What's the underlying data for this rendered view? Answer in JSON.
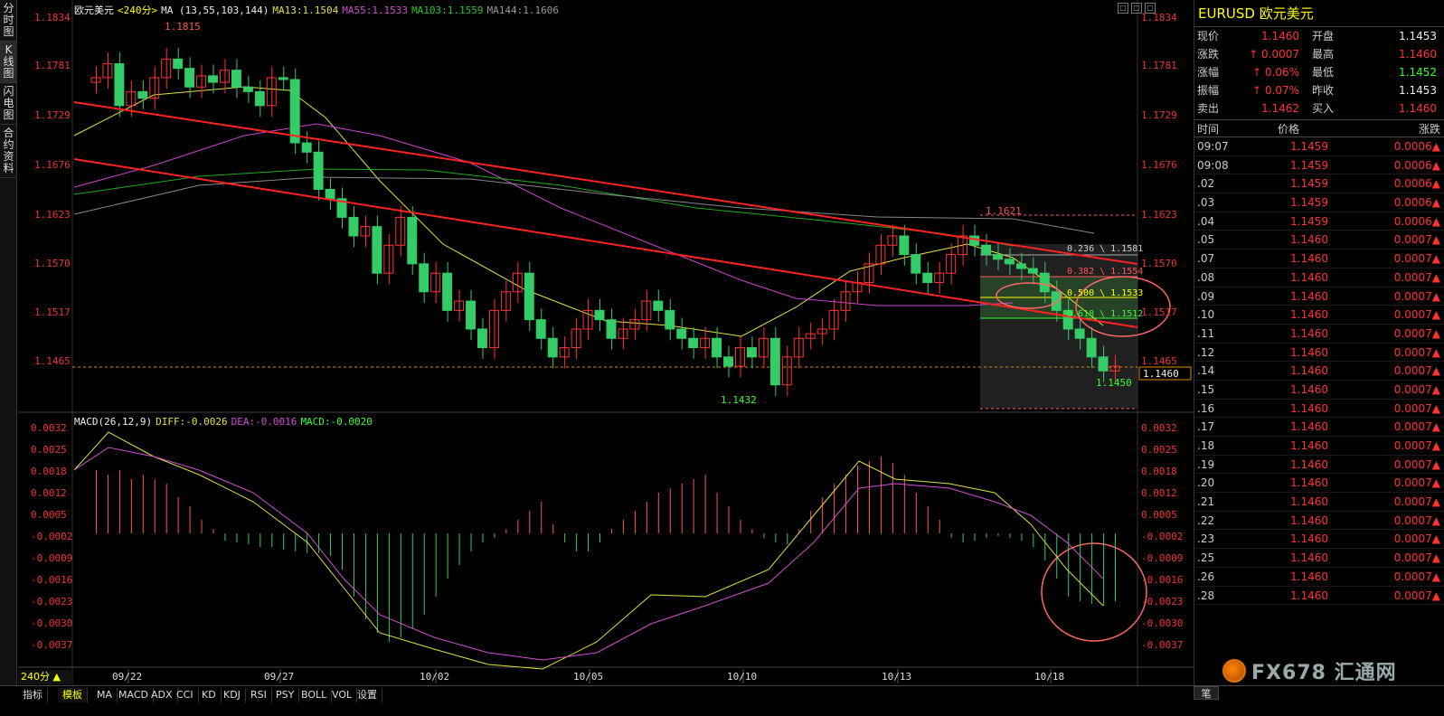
{
  "left_tabs": [
    "分时图",
    "K线图",
    "闪电图",
    "合约资料"
  ],
  "header": {
    "symbol": "欧元美元",
    "period": "<240分>",
    "ma_title": "MA (13,55,103,144)",
    "ma13": "MA13:1.1504",
    "ma55": "MA55:1.1533",
    "ma103": "MA103:1.1559",
    "ma144": "MA144:1.1606"
  },
  "window_buttons": [
    "□",
    "□",
    "□"
  ],
  "macd_header": {
    "title": "MACD(26,12,9)",
    "diff": "DIFF:-0.0026",
    "dea": "DEA:-0.0016",
    "macd": "MACD:-0.0020"
  },
  "price_axis": [
    "1.1834",
    "1.1781",
    "1.1729",
    "1.1676",
    "1.1623",
    "1.1570",
    "1.1517",
    "1.1465"
  ],
  "macd_axis": [
    "0.0032",
    "0.0025",
    "0.0018",
    "0.0012",
    "0.0005",
    "-0.0002",
    "-0.0009",
    "-0.0016",
    "-0.0023",
    "-0.0030",
    "-0.0037"
  ],
  "x_labels": [
    "09/22",
    "09/27",
    "10/02",
    "10/05",
    "10/10",
    "10/13",
    "10/18"
  ],
  "annotations": {
    "high": "1.1815",
    "low": "1.1432",
    "peak": "1.1621",
    "last_low": "1.1450",
    "current_tag": "1.1460",
    "fib_236": "0.236 \\ 1.1581",
    "fib_382": "0.382 \\ 1.1554",
    "fib_500": "0.500 \\ 1.1533",
    "fib_618": "0.618 \\ 1.1512"
  },
  "timeframe_button": "240分 ▲",
  "bottom_tabs": [
    "指标",
    "模板",
    "MA",
    "MACD",
    "ADX",
    "CCI",
    "KD",
    "KDJ",
    "RSI",
    "PSY",
    "BOLL",
    "VOL",
    "设置"
  ],
  "quote": {
    "title": "EURUSD 欧元美元",
    "rows": [
      {
        "l1": "现价",
        "v1": "1.1460",
        "c1": "red",
        "l2": "开盘",
        "v2": "1.1453",
        "c2": "white"
      },
      {
        "l1": "涨跌",
        "v1": "↑ 0.0007",
        "c1": "red",
        "l2": "最高",
        "v2": "1.1460",
        "c2": "red"
      },
      {
        "l1": "涨幅",
        "v1": "↑ 0.06%",
        "c1": "red",
        "l2": "最低",
        "v2": "1.1452",
        "c2": "green"
      },
      {
        "l1": "振幅",
        "v1": "↑ 0.07%",
        "c1": "red",
        "l2": "昨收",
        "v2": "1.1453",
        "c2": "white"
      },
      {
        "l1": "卖出",
        "v1": "1.1462",
        "c1": "red",
        "l2": "买入",
        "v2": "1.1460",
        "c2": "red"
      }
    ],
    "tick_header": [
      "时间",
      "价格",
      "涨跌"
    ],
    "ticks": [
      {
        "t": "09:07",
        "p": "1.1459",
        "c": "0.0006"
      },
      {
        "t": "09:08",
        "p": "1.1459",
        "c": "0.0006"
      },
      {
        "t": ".02",
        "p": "1.1459",
        "c": "0.0006"
      },
      {
        "t": ".03",
        "p": "1.1459",
        "c": "0.0006"
      },
      {
        "t": ".04",
        "p": "1.1459",
        "c": "0.0006"
      },
      {
        "t": ".05",
        "p": "1.1460",
        "c": "0.0007"
      },
      {
        "t": ".07",
        "p": "1.1460",
        "c": "0.0007"
      },
      {
        "t": ".08",
        "p": "1.1460",
        "c": "0.0007"
      },
      {
        "t": ".09",
        "p": "1.1460",
        "c": "0.0007"
      },
      {
        "t": ".10",
        "p": "1.1460",
        "c": "0.0007"
      },
      {
        "t": ".11",
        "p": "1.1460",
        "c": "0.0007"
      },
      {
        "t": ".12",
        "p": "1.1460",
        "c": "0.0007"
      },
      {
        "t": ".14",
        "p": "1.1460",
        "c": "0.0007"
      },
      {
        "t": ".15",
        "p": "1.1460",
        "c": "0.0007"
      },
      {
        "t": ".16",
        "p": "1.1460",
        "c": "0.0007"
      },
      {
        "t": ".17",
        "p": "1.1460",
        "c": "0.0007"
      },
      {
        "t": ".18",
        "p": "1.1460",
        "c": "0.0007"
      },
      {
        "t": ".19",
        "p": "1.1460",
        "c": "0.0007"
      },
      {
        "t": ".20",
        "p": "1.1460",
        "c": "0.0007"
      },
      {
        "t": ".21",
        "p": "1.1460",
        "c": "0.0007"
      },
      {
        "t": ".22",
        "p": "1.1460",
        "c": "0.0007"
      },
      {
        "t": ".23",
        "p": "1.1460",
        "c": "0.0007"
      },
      {
        "t": ".25",
        "p": "1.1460",
        "c": "0.0007"
      },
      {
        "t": ".26",
        "p": "1.1460",
        "c": "0.0007"
      },
      {
        "t": ".28",
        "p": "1.1460",
        "c": "0.0007"
      }
    ]
  },
  "watermark": "FX678 汇通网",
  "pen_button": "笔",
  "colors": {
    "up": "#ff3333",
    "down": "#33cc66",
    "ma13": "#e0e040",
    "ma55": "#22aa22",
    "ma103": "#cc44cc",
    "ma144": "#888888",
    "trend": "#ff2222"
  }
}
